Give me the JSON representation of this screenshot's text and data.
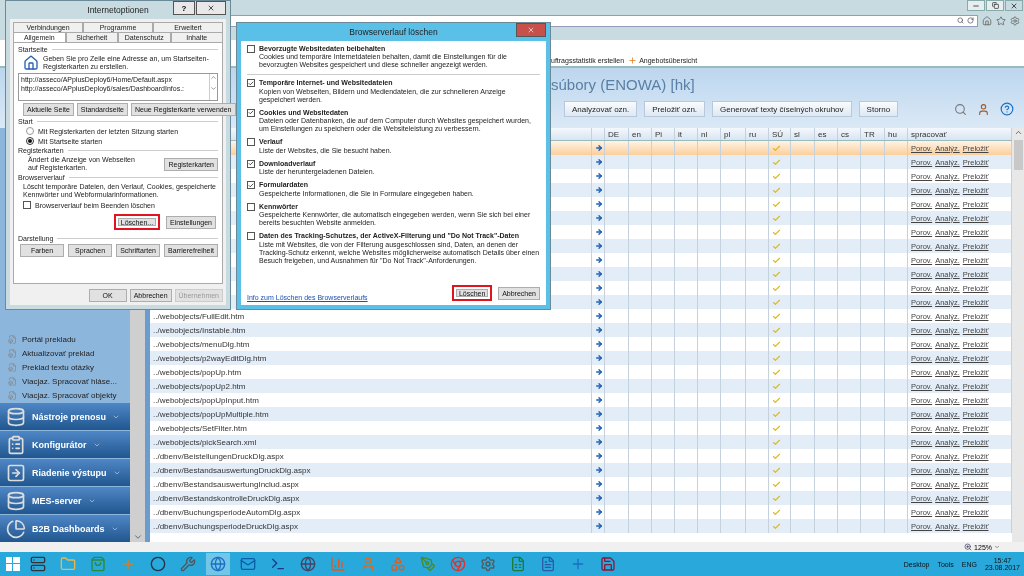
{
  "browser": {
    "favorites": [
      {
        "label": "uftragsstatistik erstellen"
      },
      {
        "label": "Angebotsübersicht"
      }
    ],
    "status_bar": {
      "zoom": "125%"
    }
  },
  "app": {
    "title": "súbory (ENOWA) [hk]",
    "toolbar": [
      "Analyzovať ozn.",
      "Preložiť ozn.",
      "Generovať texty číselných okruhov",
      "Storno"
    ]
  },
  "sidebar": {
    "items": [
      "Portál prekladu",
      "Aktualizovať preklad",
      "Preklad textu otázky",
      "Viacjaz. Spracovať hláse...",
      "Viacjaz. Spracovať objekty"
    ],
    "sections": [
      {
        "label": "Nástroje prenosu",
        "kind": "database"
      },
      {
        "label": "Konfigurátor",
        "kind": "form"
      },
      {
        "label": "Riadenie výstupu",
        "kind": "output"
      },
      {
        "label": "MES-server",
        "kind": "database"
      },
      {
        "label": "B2B Dashboards",
        "kind": "chart"
      }
    ]
  },
  "table": {
    "columns": [
      "DE",
      "en",
      "Pi",
      "it",
      "nl",
      "pl",
      "ru",
      "SÚ",
      "sl",
      "es",
      "cs",
      "TR",
      "hu",
      "spracovať"
    ],
    "rows": [
      {
        "selected": true,
        "su": true,
        "actions": [
          "Porov.",
          "Analýz.",
          "Preložiť"
        ]
      },
      {
        "selected": false,
        "su": true,
        "actions": [
          "Porov.",
          "Analýz.",
          "Preložiť"
        ]
      },
      {
        "selected": false,
        "su": true,
        "actions": [
          "Porov.",
          "Analýz.",
          "Preložiť"
        ]
      },
      {
        "selected": false,
        "su": true,
        "actions": [
          "Porov.",
          "Analýz.",
          "Preložiť"
        ]
      },
      {
        "selected": false,
        "su": true,
        "actions": [
          "Porov.",
          "Analýz.",
          "Preložiť"
        ]
      },
      {
        "selected": false,
        "su": true,
        "actions": [
          "Porov.",
          "Analýz.",
          "Preložiť"
        ]
      },
      {
        "selected": false,
        "su": true,
        "actions": [
          "Porov.",
          "Analýz.",
          "Preložiť"
        ]
      },
      {
        "selected": false,
        "su": true,
        "actions": [
          "Porov.",
          "Analýz.",
          "Preložiť"
        ]
      },
      {
        "selected": false,
        "su": true,
        "actions": [
          "Porov.",
          "Analýz.",
          "Preložiť"
        ]
      },
      {
        "selected": false,
        "su": true,
        "actions": [
          "Porov.",
          "Analýz.",
          "Preložiť"
        ]
      },
      {
        "selected": false,
        "su": true,
        "actions": [
          "Porov.",
          "Analýz.",
          "Preložiť"
        ]
      },
      {
        "selected": false,
        "su": true,
        "actions": [
          "Porov.",
          "Analýz.",
          "Preložiť"
        ]
      },
      {
        "path": "../webobjects/FullEdit.htm",
        "selected": false,
        "su": true,
        "actions": [
          "Porov.",
          "Analýz.",
          "Preložiť"
        ]
      },
      {
        "path": "../webobjects/Instable.htm",
        "selected": false,
        "su": true,
        "actions": [
          "Porov.",
          "Analýz.",
          "Preložiť"
        ]
      },
      {
        "path": "../webobjects/menuDlg.htm",
        "selected": false,
        "su": true,
        "actions": [
          "Porov.",
          "Analýz.",
          "Preložiť"
        ]
      },
      {
        "path": "../webobjects/p2wayEditDlg.htm",
        "selected": false,
        "su": true,
        "actions": [
          "Porov.",
          "Analýz.",
          "Preložiť"
        ]
      },
      {
        "path": "../webobjects/popUp.htm",
        "selected": false,
        "su": true,
        "actions": [
          "Porov.",
          "Analýz.",
          "Preložiť"
        ]
      },
      {
        "path": "../webobjects/popUp2.htm",
        "selected": false,
        "su": true,
        "actions": [
          "Porov.",
          "Analýz.",
          "Preložiť"
        ]
      },
      {
        "path": "../webobjects/popUpInput.htm",
        "selected": false,
        "su": true,
        "actions": [
          "Porov.",
          "Analýz.",
          "Preložiť"
        ]
      },
      {
        "path": "../webobjects/popUpMultiple.htm",
        "selected": false,
        "su": true,
        "actions": [
          "Porov.",
          "Analýz.",
          "Preložiť"
        ]
      },
      {
        "path": "../webobjects/SetFilter.htm",
        "selected": false,
        "su": true,
        "actions": [
          "Porov.",
          "Analýz.",
          "Preložiť"
        ]
      },
      {
        "path": "../webobjects/pickSearch.xml",
        "selected": false,
        "su": true,
        "actions": [
          "Porov.",
          "Analýz.",
          "Preložiť"
        ]
      },
      {
        "path": "../dbenv/BeistellungenDruckDlg.aspx",
        "selected": false,
        "su": true,
        "actions": [
          "Porov.",
          "Analýz.",
          "Preložiť"
        ]
      },
      {
        "path": "../dbenv/BestandsauswertungDruckDlg.aspx",
        "selected": false,
        "su": true,
        "actions": [
          "Porov.",
          "Analýz.",
          "Preložiť"
        ]
      },
      {
        "path": "../dbenv/BestandsauswertungInclud.aspx",
        "selected": false,
        "su": true,
        "actions": [
          "Porov.",
          "Analýz.",
          "Preložiť"
        ]
      },
      {
        "path": "../dbenv/BestandskontrolleDruckDlg.aspx",
        "selected": false,
        "su": true,
        "actions": [
          "Porov.",
          "Analýz.",
          "Preložiť"
        ]
      },
      {
        "path": "../dbenv/BuchungsperiodeAutomDlg.aspx",
        "selected": false,
        "su": true,
        "actions": [
          "Porov.",
          "Analýz.",
          "Preložiť"
        ]
      },
      {
        "path": "../dbenv/BuchungsperiodeDruckDlg.aspx",
        "selected": false,
        "su": true,
        "actions": [
          "Porov.",
          "Analýz.",
          "Preložiť"
        ]
      }
    ]
  },
  "internet_options": {
    "title": "Internetoptionen",
    "help": "?",
    "tabs_back": [
      {
        "label": "Verbindungen",
        "selected": false
      },
      {
        "label": "Programme",
        "selected": false
      },
      {
        "label": "Erweitert",
        "selected": false
      }
    ],
    "tabs_front": [
      {
        "label": "Allgemein",
        "selected": true
      },
      {
        "label": "Sicherheit",
        "selected": false
      },
      {
        "label": "Datenschutz",
        "selected": false
      },
      {
        "label": "Inhalte",
        "selected": false
      }
    ],
    "startseite": {
      "heading": "Startseite",
      "text": "Geben Sie pro Zeile eine Adresse an, um Startseiten-Registerkarten zu erstellen.",
      "urls": [
        "http://asseco/APplusDeploy6/Home/Default.aspx",
        "http://asseco/APplusDeploy6/sales/DashboardInfos.:"
      ],
      "buttons": [
        "Aktuelle Seite",
        "Standardseite",
        "Neue Registerkarte verwenden"
      ]
    },
    "start": {
      "heading": "Start",
      "options": [
        {
          "label": "Mit Registerkarten der letzten Sitzung starten",
          "selected": false
        },
        {
          "label": "Mit Startseite starten",
          "selected": true
        }
      ]
    },
    "registerkarten": {
      "heading": "Registerkarten",
      "text": "Ändert die Anzeige von Webseiten auf Registerkarten.",
      "button": "Registerkarten"
    },
    "browserverlauf": {
      "heading": "Browserverlauf",
      "text": "Löscht temporäre Dateien, den Verlauf, Cookies, gespeicherte Kennwörter und Webformularinformationen.",
      "checkbox": {
        "label": "Browserverlauf beim Beenden löschen",
        "checked": false
      },
      "buttons": [
        {
          "label": "Löschen...",
          "highlighted": true
        },
        {
          "label": "Einstellungen",
          "highlighted": false
        }
      ]
    },
    "darstellung": {
      "heading": "Darstellung",
      "buttons": [
        "Farben",
        "Sprachen",
        "Schriftarten",
        "Barrierefreiheit"
      ]
    },
    "footer": [
      {
        "label": "OK",
        "disabled": false
      },
      {
        "label": "Abbrechen",
        "disabled": false
      },
      {
        "label": "Übernehmen",
        "disabled": true
      }
    ]
  },
  "clear_history": {
    "title": "Browserverlauf löschen",
    "keep_option": {
      "title": "Bevorzugte Websitedaten beibehalten",
      "text": "Cookies und temporäre Internetdateien behalten, damit die Einstellungen für die bevorzugten Websites gespeichert und diese schneller angezeigt werden.",
      "checked": false
    },
    "options": [
      {
        "title": "Temporäre Internet- und Websitedateien",
        "text": "Kopien von Webseiten, Bildern und Mediendateien, die zur schnelleren Anzeige gespeichert werden.",
        "checked": true
      },
      {
        "title": "Cookies und Websitedaten",
        "text": "Dateien oder Datenbanken, die auf dem Computer durch Websites gespeichert wurden, um Einstellungen zu speichern oder die Websiteleistung zu verbessern.",
        "checked": true
      },
      {
        "title": "Verlauf",
        "text": "Liste der Websites, die Sie besucht haben.",
        "checked": false
      },
      {
        "title": "Downloadverlauf",
        "text": "Liste der heruntergeladenen Dateien.",
        "checked": true
      },
      {
        "title": "Formulardaten",
        "text": "Gespeicherte Informationen, die Sie in Formulare eingegeben haben.",
        "checked": true
      },
      {
        "title": "Kennwörter",
        "text": "Gespeicherte Kennwörter, die automatisch eingegeben werden, wenn Sie sich bei einer bereits besuchten Website anmelden.",
        "checked": false
      },
      {
        "title": "Daten des Tracking-Schutzes, der ActiveX-Filterung und \"Do Not Track\"-Daten",
        "text": "Liste mit Websites, die von der Filterung ausgeschlossen sind, Daten, an denen der Tracking-Schutz erkennt, welche Websites möglicherweise automatisch Details über einen Besuch freigeben, und Ausnahmen für \"Do Not Track\"-Anforderungen.",
        "checked": false
      }
    ],
    "link": "Info zum Löschen des Browserverlaufs",
    "buttons": [
      {
        "label": "Löschen",
        "highlighted": true
      },
      {
        "label": "Abbrechen",
        "highlighted": false
      }
    ]
  },
  "taskbar": {
    "toolbars": [
      "Desktop",
      "Tools"
    ],
    "language": "ENG",
    "time": "15:47",
    "date": "23.08.2017"
  }
}
